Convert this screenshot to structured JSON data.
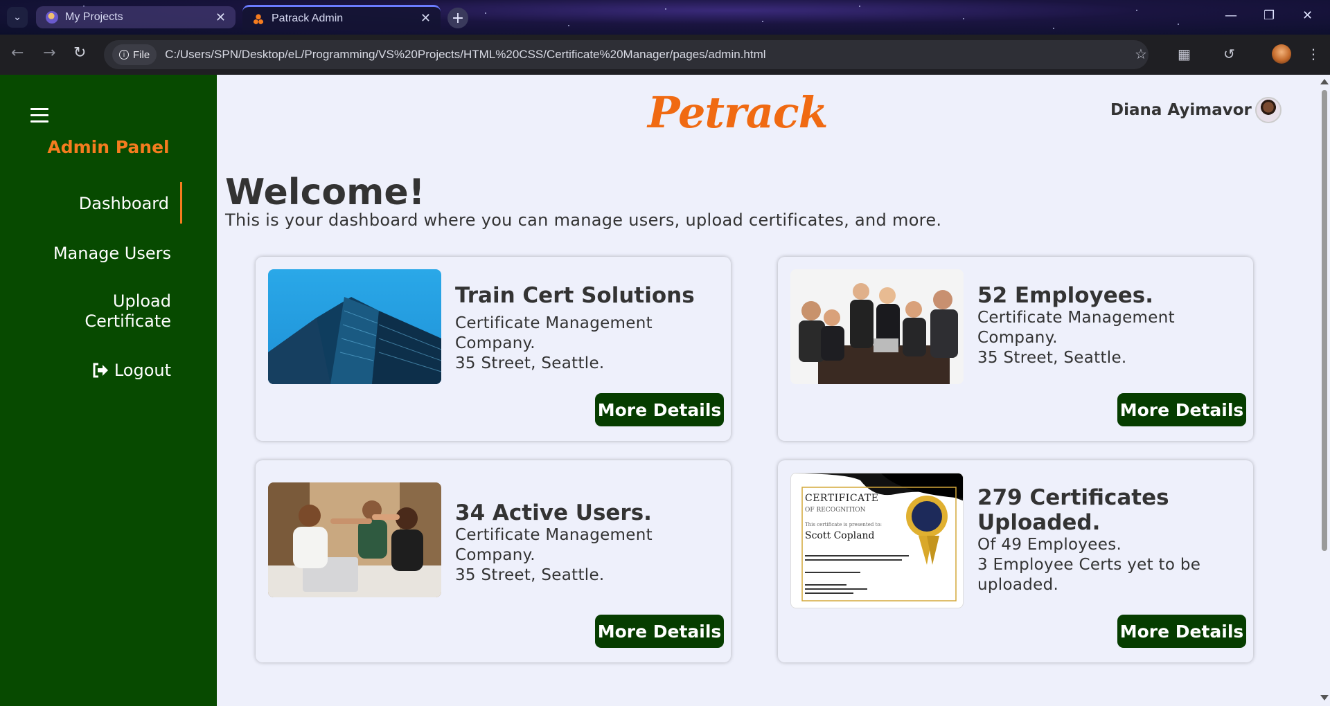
{
  "browser": {
    "tabs": [
      {
        "title": "My Projects",
        "active": false
      },
      {
        "title": "Patrack Admin",
        "active": true
      }
    ],
    "new_tab": "+",
    "address_chip": "File",
    "url": "C:/Users/SPN/Desktop/eL/Programming/VS%20Projects/HTML%20CSS/Certificate%20Manager/pages/admin.html"
  },
  "sidebar": {
    "title": "Admin Panel",
    "items": [
      {
        "label": "Dashboard",
        "active": true
      },
      {
        "label": "Manage Users",
        "active": false
      },
      {
        "label_line1": "Upload",
        "label_line2": "Certificate",
        "active": false
      },
      {
        "label": "Logout",
        "icon": "logout-icon",
        "active": false
      }
    ]
  },
  "header": {
    "brand": "Petrack",
    "user_name": "Diana Ayimavor"
  },
  "main": {
    "welcome": "Welcome!",
    "subtitle": "This is your dashboard where you can manage users, upload certificates, and more."
  },
  "cards": [
    {
      "title": "Train Cert Solutions",
      "lines": [
        "Certificate Management",
        "Company.",
        "35 Street, Seattle."
      ],
      "button": "More Details",
      "image": "office-building"
    },
    {
      "title": "52 Employees.",
      "lines": [
        "Certificate Management",
        "Company.",
        "35 Street, Seattle."
      ],
      "button": "More Details",
      "image": "business-meeting"
    },
    {
      "title": "34 Active Users.",
      "lines": [
        "Certificate Management",
        "Company.",
        "35 Street, Seattle."
      ],
      "button": "More Details",
      "image": "high-five"
    },
    {
      "title_line1": "279 Certificates",
      "title_line2": "Uploaded.",
      "lines": [
        "Of 49 Employees.",
        "3 Employee Certs yet to be",
        "uploaded."
      ],
      "button": "More Details",
      "image": "certificate"
    }
  ],
  "certificate_image": {
    "heading": "CERTIFICATE",
    "subheading": "OF RECOGNITION",
    "presented": "This certificate is presented to:",
    "name": "Scott Copland"
  },
  "colors": {
    "sidebar": "#074a00",
    "accent": "#f57c1f",
    "button": "#063d00",
    "background": "#eef0fb"
  }
}
